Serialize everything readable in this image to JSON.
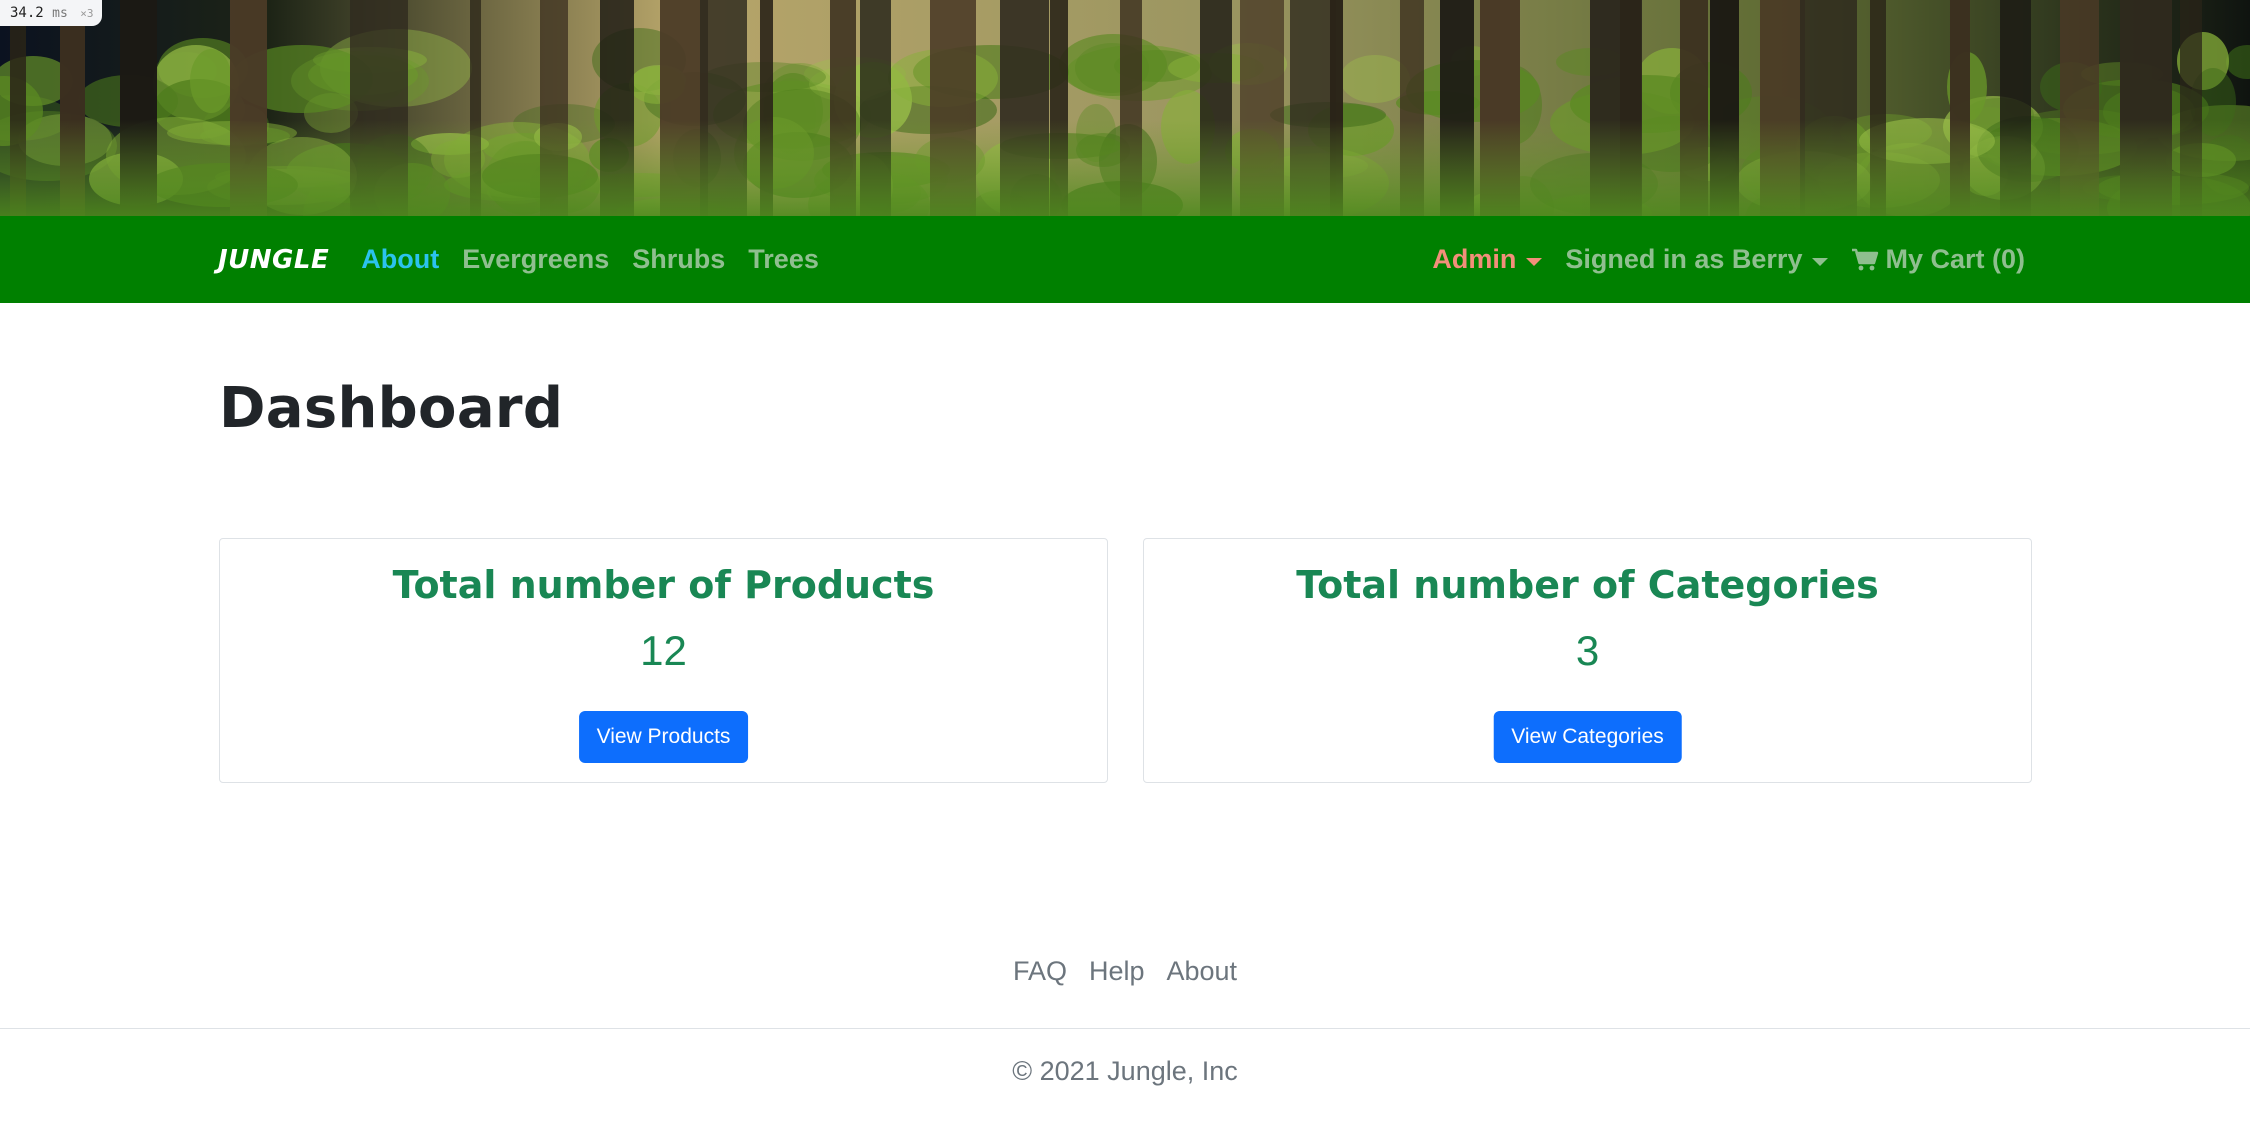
{
  "perf": {
    "value": "34.2",
    "unit": "ms",
    "multiplier": "×3"
  },
  "navbar": {
    "brand": "JUNGLE",
    "links": [
      "About",
      "Evergreens",
      "Shrubs",
      "Trees"
    ],
    "admin": "Admin",
    "user": "Signed in as Berry",
    "cart": "My Cart (0)",
    "background": "#008000",
    "active_color": "#2bc3ee",
    "admin_color": "#f38f7a"
  },
  "page": {
    "title": "Dashboard"
  },
  "cards": {
    "products": {
      "title": "Total number of Products",
      "count": "12",
      "button": "View Products"
    },
    "categories": {
      "title": "Total number of Categories",
      "count": "3",
      "button": "View Categories"
    }
  },
  "footer": {
    "links": [
      "FAQ",
      "Help",
      "About"
    ],
    "copyright": "© 2021 Jungle, Inc"
  },
  "colors": {
    "accent_green": "#198754",
    "button_blue": "#0d6efd"
  },
  "icons": {
    "cart": "cart-icon",
    "caret": "chevron-down-icon"
  }
}
